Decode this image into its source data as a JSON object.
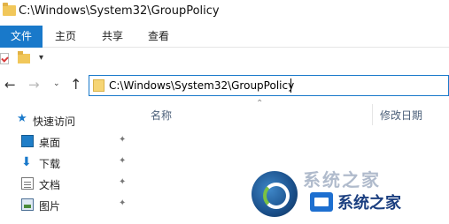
{
  "window": {
    "title": "C:\\Windows\\System32\\GroupPolicy"
  },
  "ribbon": {
    "tabs": [
      "文件",
      "主页",
      "共享",
      "查看"
    ]
  },
  "quick_access_toolbar": {
    "dropdown_glyph": "▾"
  },
  "navigation": {
    "back_glyph": "←",
    "forward_glyph": "→",
    "recent_glyph": "⌄",
    "up_glyph": "↑"
  },
  "address_bar": {
    "path": "C:\\Windows\\System32\\GroupPolicy"
  },
  "sidebar": {
    "items": [
      {
        "label": "快速访问",
        "icon": "star-icon"
      },
      {
        "label": "桌面",
        "icon": "desktop-icon",
        "pinned": true
      },
      {
        "label": "下载",
        "icon": "download-icon",
        "pinned": true
      },
      {
        "label": "文档",
        "icon": "document-icon",
        "pinned": true
      },
      {
        "label": "图片",
        "icon": "pictures-icon",
        "pinned": true
      }
    ],
    "pin_glyph": "✦"
  },
  "file_list": {
    "columns": [
      "名称",
      "修改日期"
    ],
    "sort_glyph": "⌃"
  },
  "watermark": {
    "faded_text": "系统之家",
    "text": "系统之家"
  },
  "colors": {
    "accent": "#1979ca",
    "folder": "#f1c75a",
    "watermark_text": "#1b3f80"
  }
}
